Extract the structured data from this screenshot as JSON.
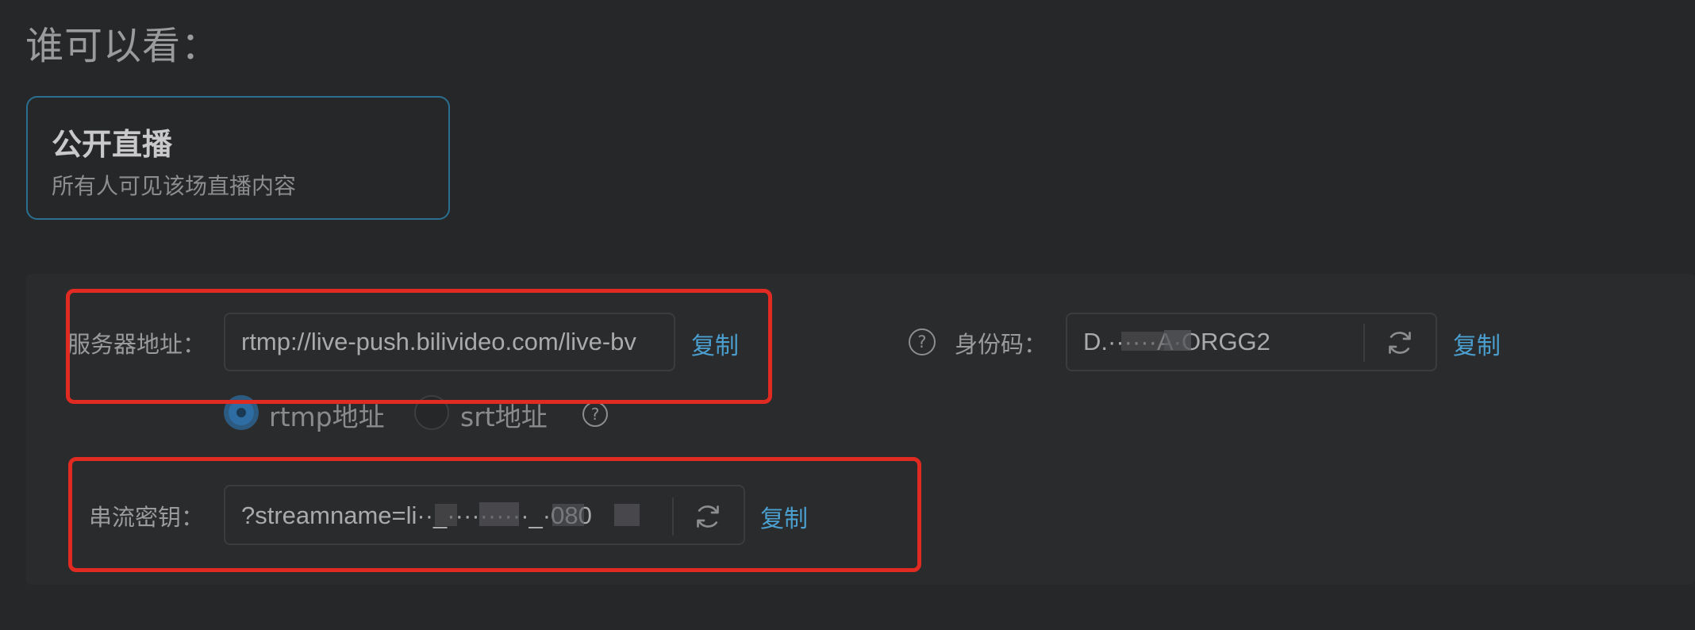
{
  "visibility": {
    "title": "谁可以看：",
    "option": {
      "title": "公开直播",
      "description": "所有人可见该场直播内容"
    }
  },
  "stream": {
    "server": {
      "label": "服务器地址：",
      "value": "rtmp://live-push.bilivideo.com/live-bv",
      "copy_label": "复制"
    },
    "protocol": {
      "options": [
        {
          "label": "rtmp地址",
          "selected": true
        },
        {
          "label": "srt地址",
          "selected": false
        }
      ],
      "help_icon": "question-circle-icon"
    },
    "identity": {
      "help_icon": "question-circle-icon",
      "label": "身份码：",
      "value": "D.······A·ORGG2",
      "refresh_icon": "refresh-icon",
      "copy_label": "复制"
    },
    "key": {
      "label": "串流密钥：",
      "value": "?streamname=li··_··········_·080",
      "refresh_icon": "refresh-icon",
      "copy_label": "复制"
    }
  },
  "colors": {
    "background": "#262729",
    "panel": "#2a2b2d",
    "accent": "#4a9fcf",
    "card_border": "#2b6f90",
    "highlight": "#e02a22",
    "radio_selected": "#2d6da3"
  }
}
